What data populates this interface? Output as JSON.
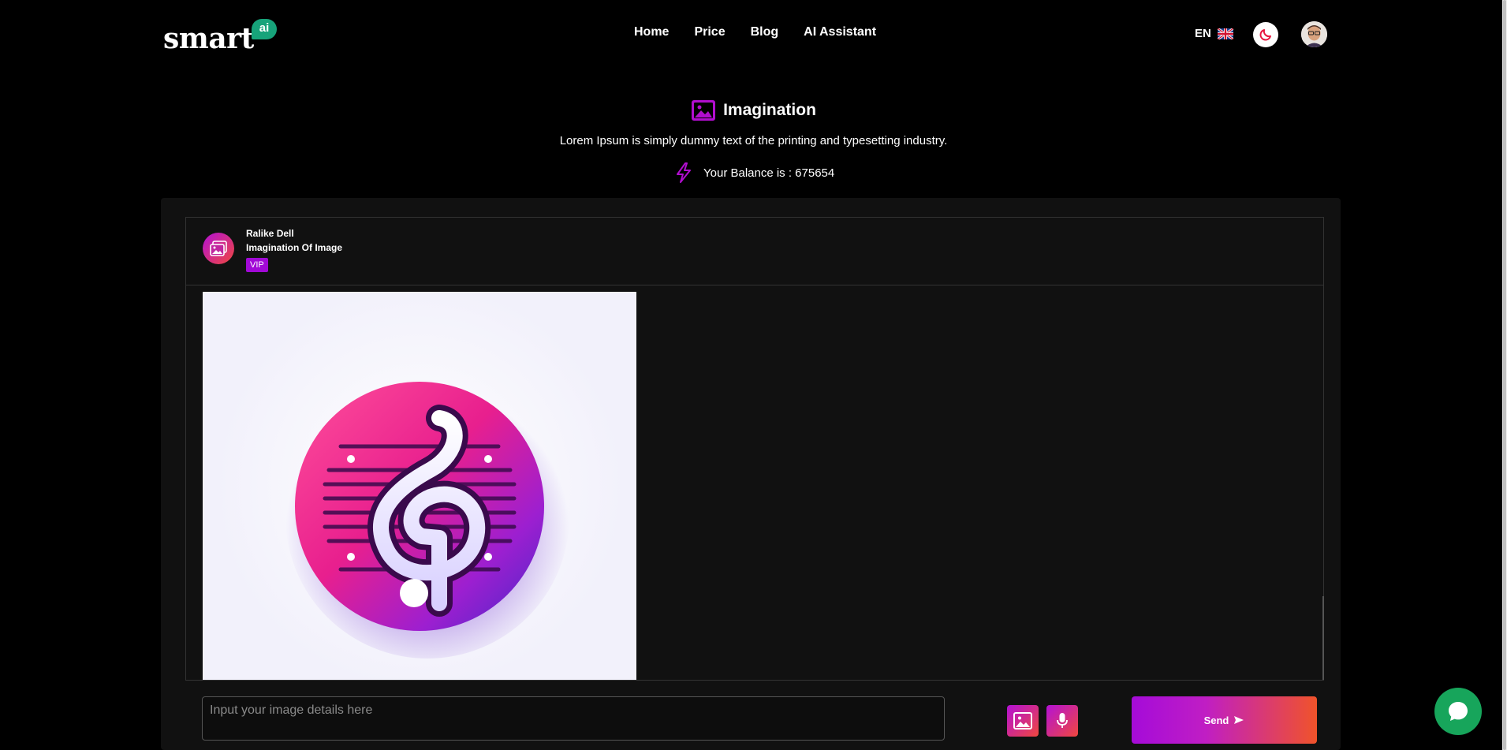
{
  "brand": {
    "logo_text": "smart",
    "logo_badge": "ai"
  },
  "nav": {
    "links": [
      "Home",
      "Price",
      "Blog",
      "AI Assistant"
    ]
  },
  "lang": {
    "code": "EN"
  },
  "page": {
    "title": "Imagination",
    "subtitle": "Lorem Ipsum is simply dummy text of the printing and typesetting industry.",
    "balance": "Your Balance is : 675654"
  },
  "chat": {
    "bot_name": "Ralike Dell",
    "bot_subtitle": "Imagination Of Image",
    "badge": "VIP"
  },
  "composer": {
    "placeholder": "Input your image details here",
    "send_label": "Send"
  },
  "colors": {
    "accent_start": "#a50bd9",
    "accent_end": "#f0532a",
    "chat_widget": "#17a55b",
    "logo_badge": "#17a37a"
  }
}
